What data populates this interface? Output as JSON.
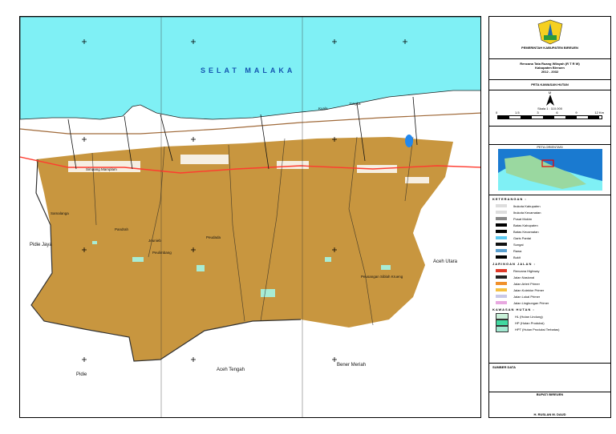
{
  "map": {
    "sea_label": "SELAT MALAKA",
    "places": [
      {
        "name": "Samalanga"
      },
      {
        "name": "Pandrah"
      },
      {
        "name": "Jeunieb"
      },
      {
        "name": "Peudada"
      },
      {
        "name": "Peulimbang"
      },
      {
        "name": "Simpang Mamplam"
      },
      {
        "name": "Kuala"
      },
      {
        "name": "Jangka"
      },
      {
        "name": "Peusangan Siblah Krueng"
      }
    ],
    "neighbors": {
      "pidie_jaya": "Pidie Jaya",
      "aceh_utara": "Aceh Utara",
      "aceh_tengah": "Aceh Tengah",
      "bener_meriah": "Bener Meriah",
      "pidie": "Pidie"
    },
    "colors": {
      "sea": "#7ff0f5",
      "forest": "#c8963f",
      "land": "#ffffff",
      "highway": "#ff3b2f"
    }
  },
  "panel": {
    "agency": "PEMERINTAH KABUPATEN BIREUEN",
    "plan_title": "Rencana Tata Ruang Wilayah (R T R W)",
    "plan_sub": "Kabupaten Bireuen",
    "plan_years": "2012 - 2032",
    "map_title": "PETA KAWASAN HUTAN",
    "north": "U",
    "scale": "Skala 1 : 110.000",
    "scale_ticks": [
      "0",
      "1.5",
      "3",
      "6",
      "9",
      "12 Km"
    ],
    "inset_title": "PETA ORIENTASI",
    "legend_title": "KETERANGAN :",
    "legend": [
      "Ibukota Kabupaten",
      "Ibukota Kecamatan",
      "Pusat Mukim",
      "Batas Kabupaten",
      "Batas Kecamatan",
      "Garis Pantai",
      "Sungai",
      "Rawa",
      "Bukit"
    ],
    "roads_title": "JARINGAN JALAN :",
    "roads": [
      {
        "label": "Rencana Highway",
        "color": "#e03a2a"
      },
      {
        "label": "Jalan Nasional",
        "color": "#222"
      },
      {
        "label": "Jalan Arteri Primer",
        "color": "#f0902a"
      },
      {
        "label": "Jalan Kolektor Primer",
        "color": "#f5c040"
      },
      {
        "label": "Jalan Lokal Primer",
        "color": "#c8c8e8"
      },
      {
        "label": "Jalan Lingkungan Primer",
        "color": "#e8a8e0"
      }
    ],
    "forest_title": "KAWASAN HUTAN :",
    "forest": [
      {
        "label": "HL (Hutan Lindung)",
        "color": "#c8f0d8"
      },
      {
        "label": "HP (Hutan Produksi)",
        "color": "#40d8a0"
      },
      {
        "label": "HPT (Hutan Produksi Terbatas)",
        "color": "#a0e8d0"
      }
    ],
    "sources_title": "SUMBER DATA",
    "approval": "BUPATI BIREUEN",
    "signer": "H. RUSLAN M. DAUD"
  }
}
